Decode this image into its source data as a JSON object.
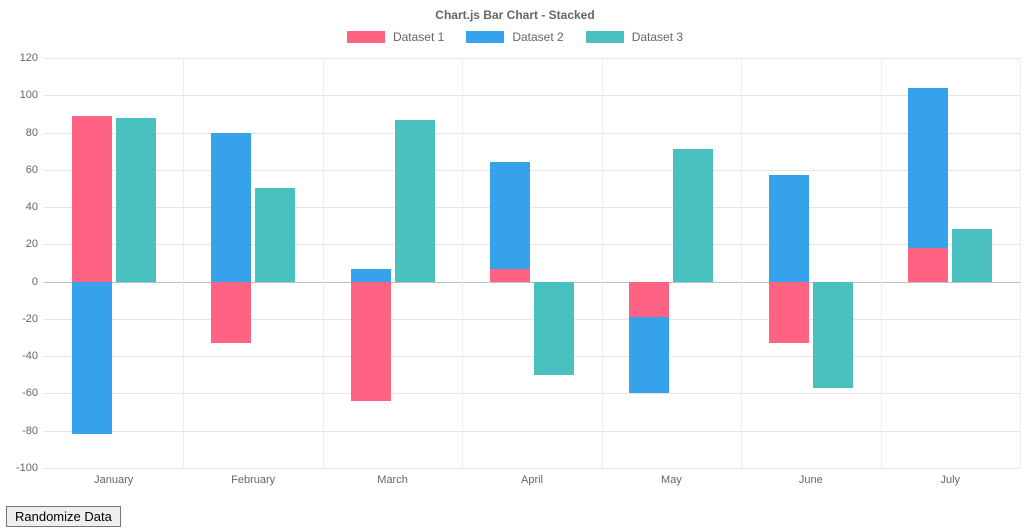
{
  "title": "Chart.js Bar Chart - Stacked",
  "button_label": "Randomize Data",
  "legend": {
    "d1": "Dataset 1",
    "d2": "Dataset 2",
    "d3": "Dataset 3"
  },
  "colors": {
    "d1": "#ff6384",
    "d2": "#36a2eb",
    "d3": "#4bc0c0"
  },
  "chart_data": {
    "type": "bar",
    "title": "Chart.js Bar Chart - Stacked",
    "stacked": true,
    "categories": [
      "January",
      "February",
      "March",
      "April",
      "May",
      "June",
      "July"
    ],
    "series": [
      {
        "name": "Dataset 1",
        "color": "#ff6384",
        "values": [
          89,
          -33,
          -64,
          7,
          -19,
          -33,
          18
        ]
      },
      {
        "name": "Dataset 2",
        "color": "#36a2eb",
        "values": [
          -82,
          80,
          7,
          57,
          -41,
          57,
          86
        ]
      },
      {
        "name": "Dataset 3",
        "color": "#4bc0c0",
        "values": [
          88,
          50,
          87,
          -50,
          71,
          -57,
          28
        ]
      }
    ],
    "yticks": [
      -100,
      -80,
      -60,
      -40,
      -20,
      0,
      20,
      40,
      60,
      80,
      100,
      120
    ],
    "ylim": [
      -100,
      120
    ],
    "xlabel": "",
    "ylabel": "",
    "legend_position": "top",
    "grid": true
  }
}
